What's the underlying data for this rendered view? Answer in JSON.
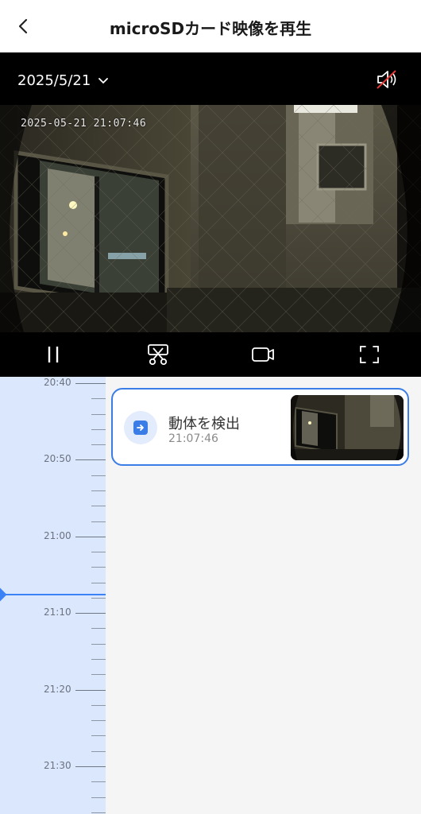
{
  "header": {
    "title": "microSDカード映像を再生"
  },
  "player": {
    "date": "2025/5/21",
    "osd_timestamp": "2025-05-21  21:07:46"
  },
  "timeline": {
    "labels": [
      "20:40",
      "20:50",
      "21:00",
      "21:10",
      "21:20",
      "21:30"
    ],
    "current_position": "21:07:46"
  },
  "events": [
    {
      "title": "動体を検出",
      "time": "21:07:46"
    }
  ],
  "icons": {
    "back": "chevron-left-icon",
    "date_dropdown": "chevron-down-icon",
    "mute": "speaker-muted-icon",
    "pause": "pause-icon",
    "clip": "scissors-icon",
    "record": "video-camera-icon",
    "fullscreen": "fullscreen-icon",
    "event": "motion-arrow-icon"
  },
  "colors": {
    "accent": "#3b7de6",
    "timeline_bg": "#dbe7fd"
  }
}
